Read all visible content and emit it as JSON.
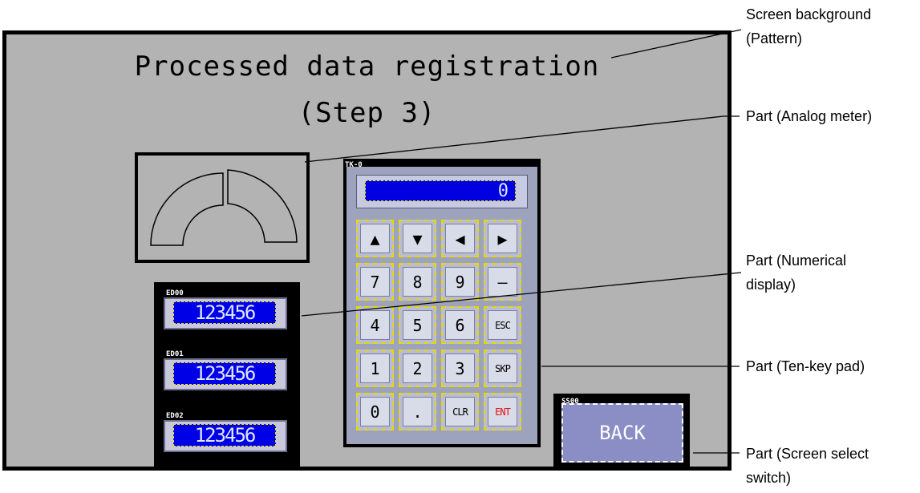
{
  "screen": {
    "title_line1": "Processed data registration",
    "title_line2": "(Step 3)"
  },
  "numerical_displays": [
    {
      "tag": "ED00",
      "value": "123456"
    },
    {
      "tag": "ED01",
      "value": "123456"
    },
    {
      "tag": "ED02",
      "value": "123456"
    }
  ],
  "tenkey": {
    "tag": "TK-0",
    "display_value": "0",
    "keys": [
      "▲",
      "▼",
      "◀",
      "▶",
      "7",
      "8",
      "9",
      "–",
      "4",
      "5",
      "6",
      "ESC",
      "1",
      "2",
      "3",
      "SKP",
      "0",
      ".",
      "CLR",
      "ENT"
    ]
  },
  "back_switch": {
    "tag": "SS00",
    "label": "BACK"
  },
  "callouts": {
    "screen_background": {
      "line1": "Screen background",
      "line2": "(Pattern)"
    },
    "analog_meter": {
      "line1": "Part (Analog meter)"
    },
    "numerical_display": {
      "line1": "Part (Numerical",
      "line2": "display)"
    },
    "tenkey_pad": {
      "line1": "Part (Ten-key pad)"
    },
    "screen_select": {
      "line1": "Part (Screen select",
      "line2": "switch)"
    }
  }
}
